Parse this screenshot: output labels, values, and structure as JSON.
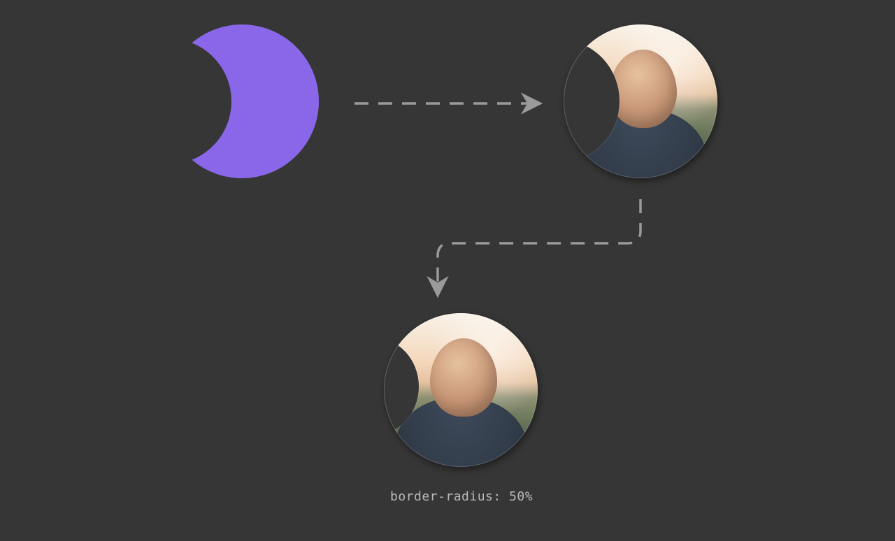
{
  "diagram": {
    "steps": {
      "mask_shape": {
        "name": "Crescent mask shape"
      },
      "masked_avatar": {
        "name": "Avatar with crescent mask applied"
      },
      "rounded_avatar": {
        "name": "Masked avatar with border-radius"
      }
    },
    "caption_code": "border-radius: 50%",
    "mask": {
      "type": "crescent-moon"
    },
    "colors": {
      "background": "#363636",
      "accent": "#8a67e8",
      "arrow": "#9a9a9a",
      "text": "#b9b9b9",
      "avatar_shirt": "#323c4a",
      "avatar_skin": "#c79676"
    },
    "arrows": {
      "style": "dashed",
      "a_to_b": {
        "from": "mask_shape",
        "to": "masked_avatar"
      },
      "b_to_c": {
        "from": "masked_avatar",
        "to": "rounded_avatar"
      }
    }
  }
}
